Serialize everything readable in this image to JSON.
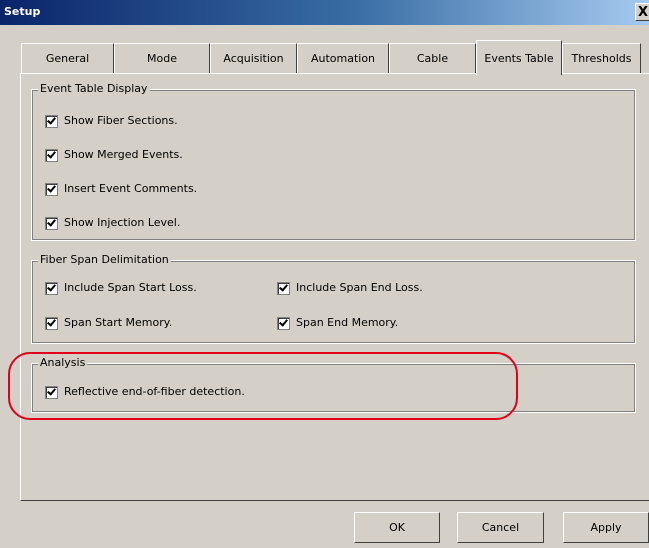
{
  "window": {
    "title": "Setup",
    "close_label": "X"
  },
  "tabs": [
    {
      "label": "General",
      "active": false
    },
    {
      "label": "Mode",
      "active": false
    },
    {
      "label": "Acquisition",
      "active": false
    },
    {
      "label": "Automation",
      "active": false
    },
    {
      "label": "Cable",
      "active": false
    },
    {
      "label": "Events Table",
      "active": true
    },
    {
      "label": "Thresholds",
      "active": false
    }
  ],
  "event_table_display": {
    "title": "Event Table Display",
    "items": [
      {
        "label": "Show Fiber Sections.",
        "checked": true
      },
      {
        "label": "Show Merged Events.",
        "checked": true
      },
      {
        "label": "Insert Event Comments.",
        "checked": true
      },
      {
        "label": "Show Injection Level.",
        "checked": true
      }
    ]
  },
  "fiber_span": {
    "title": "Fiber Span Delimitation",
    "items": [
      {
        "label": "Include Span Start Loss.",
        "checked": true
      },
      {
        "label": "Include Span End Loss.",
        "checked": true
      },
      {
        "label": "Span Start Memory.",
        "checked": true
      },
      {
        "label": "Span End Memory.",
        "checked": true
      }
    ]
  },
  "analysis": {
    "title": "Analysis",
    "items": [
      {
        "label": "Reflective end-of-fiber detection.",
        "checked": true
      }
    ]
  },
  "buttons": {
    "ok": "OK",
    "cancel": "Cancel",
    "apply": "Apply"
  },
  "colors": {
    "annotation": "#e0001b",
    "title_bar": "#0a246a",
    "dialog_bg": "#d4d0c8"
  }
}
